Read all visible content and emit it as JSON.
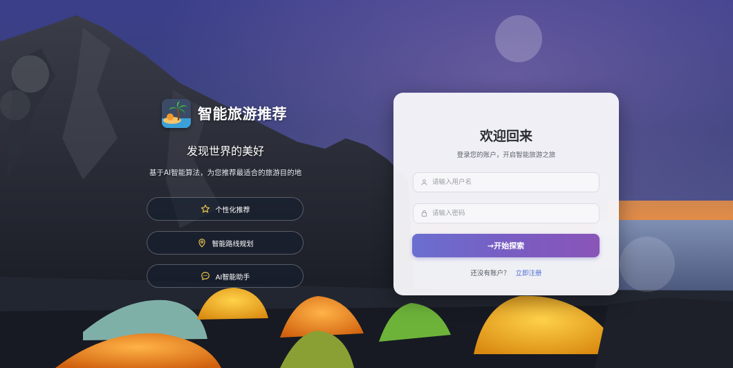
{
  "brand": {
    "title": "智能旅游推荐",
    "icon": "palm-tree-island-icon"
  },
  "hero": {
    "tagline": "发现世界的美好",
    "description": "基于AI智能算法，为您推荐最适合的旅游目的地"
  },
  "features": [
    {
      "label": "个性化推荐",
      "icon": "star-icon"
    },
    {
      "label": "智能路线规划",
      "icon": "map-pin-icon"
    },
    {
      "label": "AI智能助手",
      "icon": "chat-bubble-icon"
    }
  ],
  "login": {
    "title": "欢迎回来",
    "subtitle": "登录您的账户，开启智能旅游之旅",
    "username_placeholder": "请输入用户名",
    "password_placeholder": "请输入密码",
    "submit_label": "→开始探索",
    "register_prompt": "还没有账户？",
    "register_link": "立即注册"
  },
  "colors": {
    "accent_start": "#6a6fd0",
    "accent_end": "#8a55b8",
    "link": "#4c6bd6",
    "feature_icon": "#f2c94c"
  }
}
